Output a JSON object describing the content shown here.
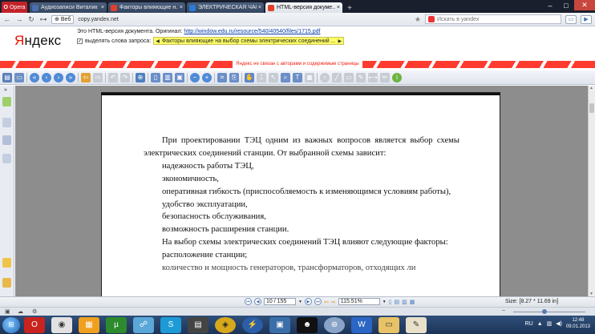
{
  "browser": {
    "menu_label": "Opera",
    "tabs": [
      {
        "label": "Аудиозаписи Виталик ...",
        "color": "#4a6fb0",
        "active": false
      },
      {
        "label": "Факторы влияющие н...",
        "color": "#e0402a",
        "active": false
      },
      {
        "label": "ЭЛЕКТРИЧЕСКАЯ ЧАС...",
        "color": "#2a7ad6",
        "active": false
      },
      {
        "label": "HTML-версия докуме...",
        "color": "#e0402a",
        "active": true
      }
    ],
    "new_tab": "+",
    "window_min": "–",
    "window_max": "□",
    "window_close": "✕",
    "web_badge": "Веб",
    "url": "copy.yandex.net",
    "search_placeholder": "Искать в yandex"
  },
  "yandex": {
    "logo_first": "Я",
    "logo_rest": "ндекс",
    "info_prefix": "Это HTML-версия документа. Оригинал: ",
    "info_link": "http://window.edu.ru/resource/540/40540/files/1715.pdf",
    "highlight_label": "выделять слова запроса:",
    "highlight_query": "Факторы влияющие на выбор схемы электрических соединений ...",
    "stripe_text": "Яндекс не связан с авторами и содержимым страницы"
  },
  "document": {
    "p1": "При проектировании ТЭЦ одним из важных вопросов является выбор схемы электрических соединений станции. От выбранной схемы зависит:",
    "items": [
      "надежность работы ТЭЦ,",
      "экономичность,",
      "оперативная гибкость (приспособляемость к изменяющимся условиям работы),",
      "удобство эксплуатации,",
      "безопасность обслуживания,",
      "возможность расширения станции."
    ],
    "p2": "На выбор схемы электрических соединений ТЭЦ влияют следующие факторы:",
    "item2": "расположение станции;",
    "cut_line": "количество и мощность генераторов, трансформаторов, отходящих ли"
  },
  "viewer": {
    "page_current": "10",
    "page_total": "/ 155",
    "zoom": "115.51%",
    "size_label": "Size: [8.27 * 11.69 in]"
  },
  "taskbar": {
    "lang": "RU",
    "time": "12:48",
    "date": "09.01.2013"
  }
}
